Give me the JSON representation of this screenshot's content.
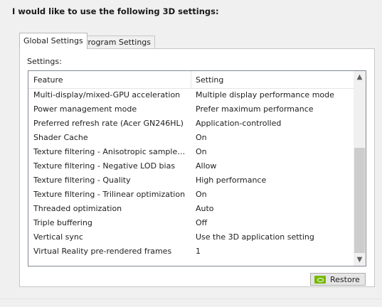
{
  "heading": "I would like to use the following 3D settings:",
  "tabs": [
    {
      "label": "Global Settings",
      "active": true
    },
    {
      "label": "Program Settings",
      "active": false
    }
  ],
  "settings_label": "Settings:",
  "columns": {
    "feature": "Feature",
    "setting": "Setting"
  },
  "rows": [
    {
      "feature": "Multi-display/mixed-GPU acceleration",
      "setting": "Multiple display performance mode"
    },
    {
      "feature": "Power management mode",
      "setting": "Prefer maximum performance"
    },
    {
      "feature": "Preferred refresh rate (Acer GN246HL)",
      "setting": "Application-controlled"
    },
    {
      "feature": "Shader Cache",
      "setting": "On"
    },
    {
      "feature": "Texture filtering - Anisotropic sample opti...",
      "setting": "On"
    },
    {
      "feature": "Texture filtering - Negative LOD bias",
      "setting": "Allow"
    },
    {
      "feature": "Texture filtering - Quality",
      "setting": "High performance"
    },
    {
      "feature": "Texture filtering - Trilinear optimization",
      "setting": "On"
    },
    {
      "feature": "Threaded optimization",
      "setting": "Auto"
    },
    {
      "feature": "Triple buffering",
      "setting": "Off"
    },
    {
      "feature": "Vertical sync",
      "setting": "Use the 3D application setting"
    },
    {
      "feature": "Virtual Reality pre-rendered frames",
      "setting": "1"
    }
  ],
  "scrollbar": {
    "up_icon": "chevron-up-icon",
    "down_icon": "chevron-down-icon"
  },
  "restore_button": {
    "label": "Restore",
    "icon": "nvidia-icon",
    "accent": "#76b900"
  }
}
